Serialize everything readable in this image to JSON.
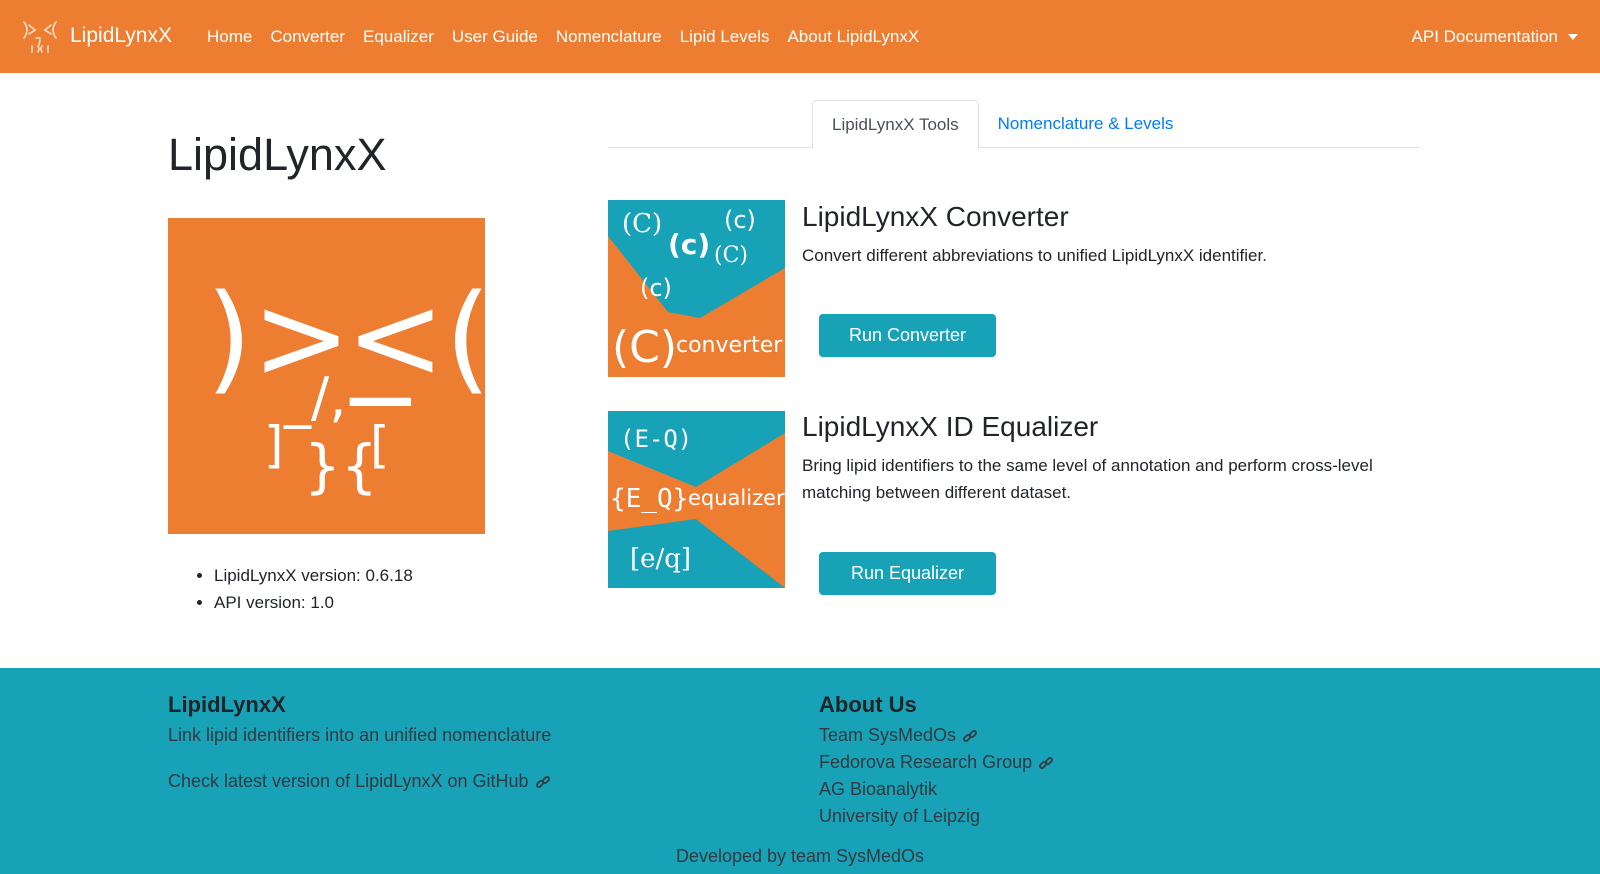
{
  "navbar": {
    "brand": "LipidLynxX",
    "links": [
      "Home",
      "Converter",
      "Equalizer",
      "User Guide",
      "Nomenclature",
      "Lipid Levels",
      "About LipidLynxX"
    ],
    "api_menu": "API Documentation",
    "background": "#ed7d31"
  },
  "main": {
    "title": "LipidLynxX",
    "logo_text": {
      "eyes_left": ")>_",
      "eyes_right": "<(",
      "mouth": "_/,",
      "brackets_left": "]",
      "brackets_mid": "}{",
      "brackets_right": "["
    },
    "versions": [
      "LipidLynxX version: 0.6.18",
      "API version: 1.0"
    ]
  },
  "tabs": [
    {
      "label": "LipidLynxX Tools",
      "active": true
    },
    {
      "label": "Nomenclature & Levels",
      "active": false
    }
  ],
  "tools": {
    "converter": {
      "title": "LipidLynxX Converter",
      "description": "Convert different abbreviations to unified LipidLynxX identifier.",
      "button": "Run Converter",
      "image_text": {
        "c1": "(C)",
        "c2": "(c)",
        "c3": "(c)",
        "c4": "(C)",
        "c5": "(c)",
        "big": "(C)",
        "word": "converter"
      }
    },
    "equalizer": {
      "title": "LipidLynxX ID Equalizer",
      "description": "Bring lipid identifiers to the same level of annotation and perform cross-level matching between different dataset.",
      "button": "Run Equalizer",
      "image_text": {
        "top": "(E-Q)",
        "mid": "{E_Q}",
        "word": "equalizer",
        "bottom": "[e/q]"
      }
    }
  },
  "footer": {
    "left": {
      "heading": "LipidLynxX",
      "tagline": "Link lipid identifiers into an unified nomenclature",
      "github": "Check latest version of LipidLynxX on GitHub"
    },
    "right": {
      "heading": "About Us",
      "links": [
        "Team SysMedOs",
        "Fedorova Research Group",
        "AG Bioanalytik",
        "University of Leipzig"
      ]
    },
    "developed_by": "Developed by team SysMedOs"
  },
  "colors": {
    "orange": "#ed7d31",
    "teal": "#17a2b8",
    "link_blue": "#007bff"
  },
  "icons": {
    "link": "link-icon",
    "caret": "caret-down-icon"
  }
}
